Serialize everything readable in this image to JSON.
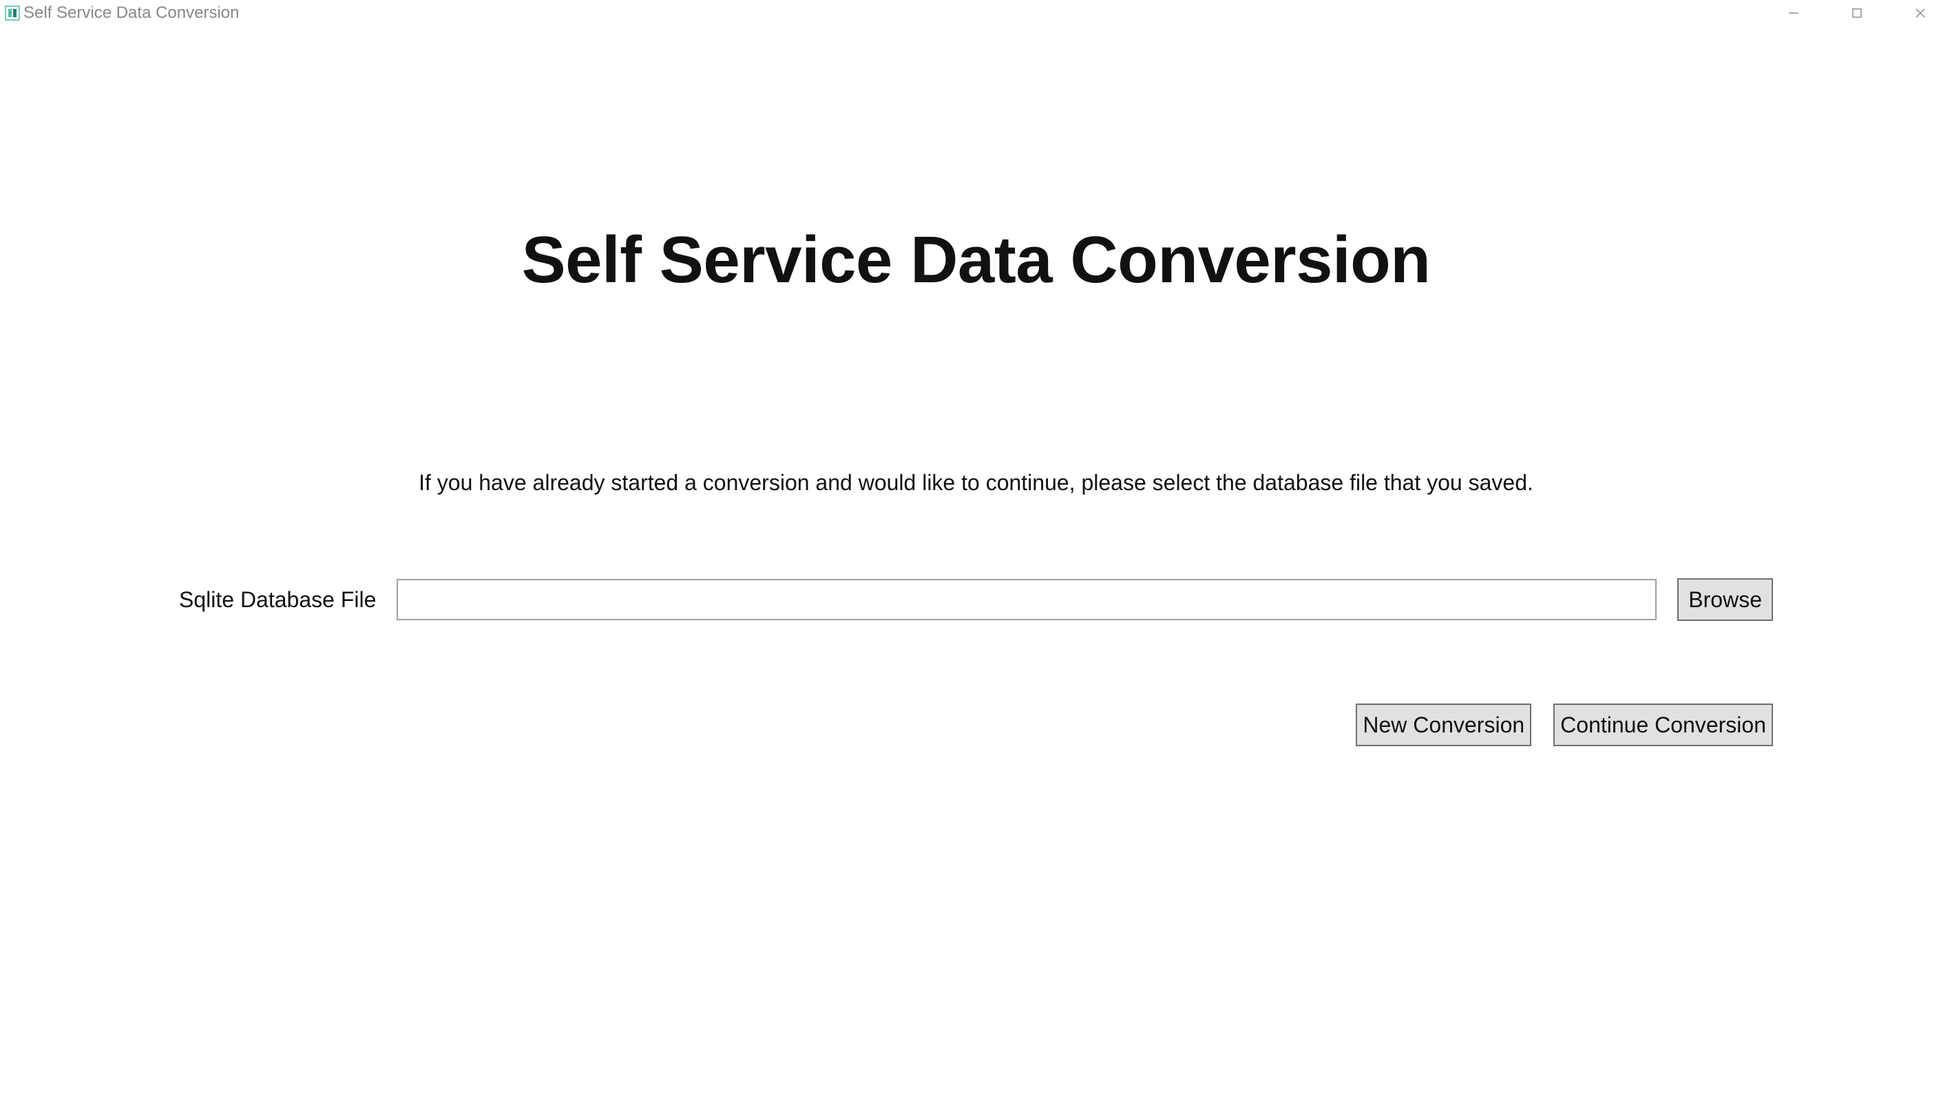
{
  "window": {
    "title": "Self Service Data Conversion"
  },
  "main": {
    "heading": "Self Service Data Conversion",
    "instructions": "If you have already started a conversion and would like to continue, please select the database file that you saved.",
    "file_label": "Sqlite Database File",
    "file_value": "",
    "browse_label": "Browse",
    "new_conversion_label": "New Conversion",
    "continue_conversion_label": "Continue Conversion"
  }
}
